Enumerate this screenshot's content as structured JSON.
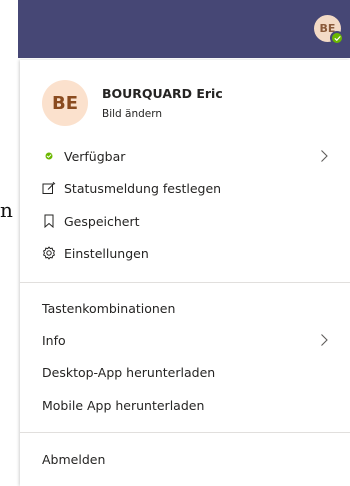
{
  "background_char": "n",
  "topbar": {
    "avatar_initials": "BE",
    "presence": "available",
    "accent_color": "#464775"
  },
  "profile": {
    "initials": "BE",
    "name": "BOURQUARD Eric",
    "change_picture": "Bild ändern"
  },
  "menu": {
    "status": {
      "label": "Verfügbar",
      "icon": "presence-available-icon",
      "color": "#6bb700"
    },
    "status_message": {
      "label": "Statusmeldung festlegen",
      "icon": "edit-icon"
    },
    "saved": {
      "label": "Gespeichert",
      "icon": "bookmark-icon"
    },
    "settings": {
      "label": "Einstellungen",
      "icon": "gear-icon"
    },
    "shortcuts": {
      "label": "Tastenkombinationen"
    },
    "info": {
      "label": "Info"
    },
    "desktop_app": {
      "label": "Desktop-App herunterladen"
    },
    "mobile_app": {
      "label": "Mobile App herunterladen"
    },
    "signout": {
      "label": "Abmelden"
    }
  }
}
